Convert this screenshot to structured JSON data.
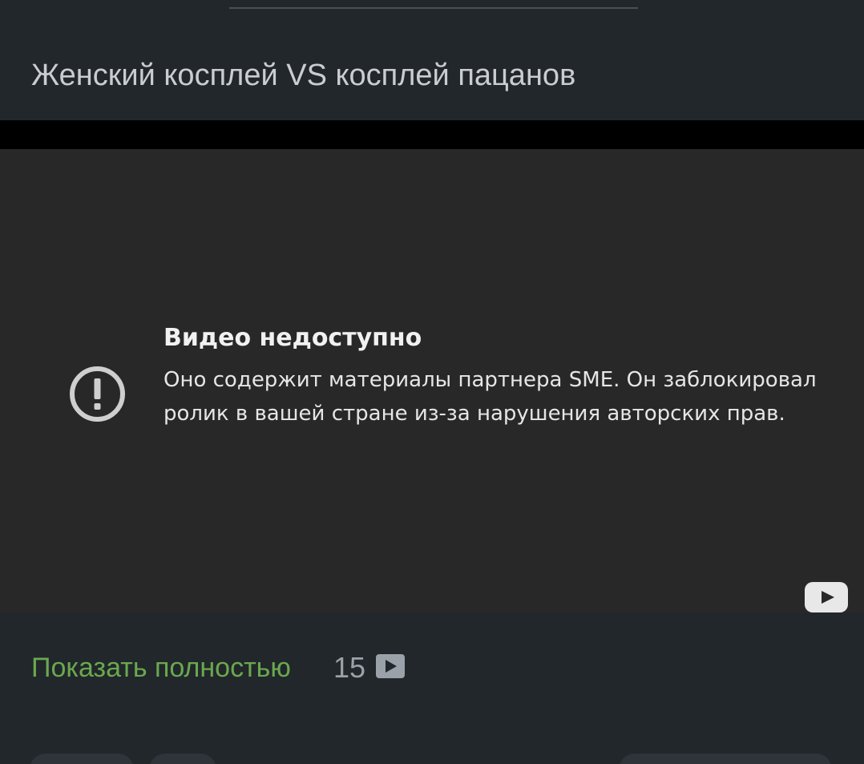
{
  "post": {
    "title": "Женский косплей VS косплей пацанов"
  },
  "video": {
    "error_heading": "Видео недоступно",
    "error_message": "Оно содержит материалы партнера SME. Он заблокировал ролик в вашей стране из-за нарушения авторских прав.",
    "error_icon": "exclamation-circle-icon",
    "platform_logo": "youtube-logo-icon"
  },
  "footer": {
    "show_more_label": "Показать полностью",
    "video_count": "15",
    "video_count_icon": "play-icon"
  },
  "colors": {
    "background": "#22272b",
    "player_background": "#282828",
    "accent_link": "#6aa84f",
    "title_text": "#c9cdd2",
    "muted_text": "#9aa1a8"
  }
}
